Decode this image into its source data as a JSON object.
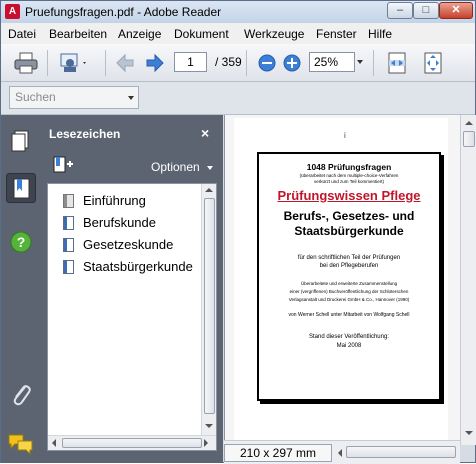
{
  "window": {
    "title": "Pruefungsfragen.pdf - Adobe Reader",
    "controls": {
      "minimize": "–",
      "maximize": "□",
      "close": "✕"
    }
  },
  "menu": [
    "Datei",
    "Bearbeiten",
    "Anzeige",
    "Dokument",
    "Werkzeuge",
    "Fenster",
    "Hilfe"
  ],
  "toolbar": {
    "current_page": "1",
    "total_pages": "/ 359",
    "zoom": "25%"
  },
  "search": {
    "placeholder": "Suchen"
  },
  "bookmarks": {
    "header": "Lesezeichen",
    "close": "×",
    "options_label": "Optionen",
    "items": [
      {
        "label": "Einführung",
        "icon": "page-gray"
      },
      {
        "label": "Berufskunde",
        "icon": "page-blue"
      },
      {
        "label": "Gesetzeskunde",
        "icon": "page-blue"
      },
      {
        "label": "Staatsbürgerkunde",
        "icon": "page-blue"
      }
    ]
  },
  "document": {
    "page_mark": "i",
    "line1": "1048 Prüfungsfragen",
    "line2a": "(überarbeitet nach dem multiple-choice-Verfahren",
    "line2b": "verkürzt und zum Teil kommentiert)",
    "heading": "Prüfungswissen Pflege",
    "subtitle_a": "Berufs-, Gesetzes- und",
    "subtitle_b": "Staatsbürgerkunde",
    "purpose_a": "für den schriftlichen Teil der Prüfungen",
    "purpose_b": "bei den Pflegeberufen",
    "source_a": "Überarbeitete und erweiterte Zusammenstellung",
    "source_b": "einer (vergriffenen) Buchveröffentlichung der Schlüterschen",
    "source_c": "Verlagsanstalt und Druckerei GmbH & Co., Hannover (1990)",
    "authors": "von Werner Schell unter Mitarbeit von Wolfgang Schell",
    "status_a": "Stand dieser Veröffentlichung:",
    "status_b": "Mai 2008",
    "page_size": "210 x 297 mm"
  },
  "colors": {
    "heading": "#c0162c",
    "rail": "#5d6471",
    "accent_blue": "#3c7fd6"
  }
}
